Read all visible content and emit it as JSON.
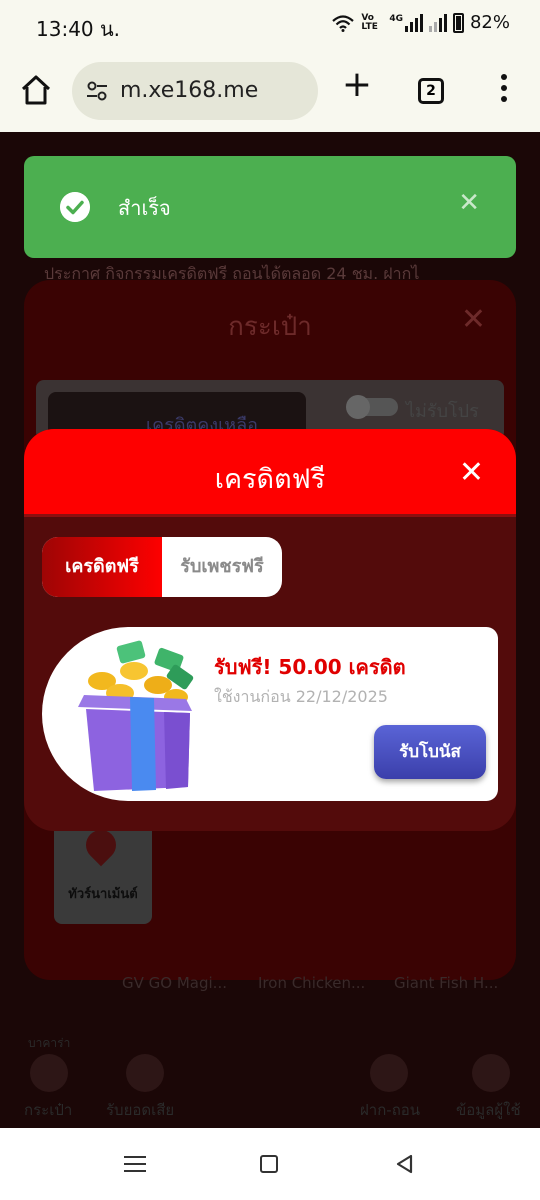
{
  "status_bar": {
    "time": "13:40 น.",
    "battery": "82%",
    "volte": "Vo LTE",
    "network": "4G"
  },
  "browser": {
    "url": "m.xe168.me",
    "tab_count": "2"
  },
  "toast": {
    "message": "สำเร็จ"
  },
  "background": {
    "marquee": "ประกาศ กิจกรรมเครดิตฟรี ถอนได้ตลอด 24 ชม. ฝากไ",
    "wallet_title": "กระเป๋า",
    "credit_label": "เครดิตคงเหลือ",
    "no_promo_label": "ไม่รับโปร",
    "tournament_label": "ทัวร์นาเม้นต์",
    "games": [
      "GV GO Magi...",
      "Iron Chicken...",
      "Giant Fish H..."
    ],
    "nav": [
      "กระเป๋า",
      "รับยอดเสีย",
      "ฝาก-ถอน",
      "ข้อมูลผู้ใช้"
    ],
    "side_label": "บาคาร่า"
  },
  "modal": {
    "title": "เครดิตฟรี",
    "tabs": [
      {
        "label": "เครดิตฟรี",
        "active": true
      },
      {
        "label": "รับเพชรฟรี",
        "active": false
      }
    ],
    "card": {
      "title": "รับฟรี! 50.00 เครดิต",
      "date": "ใช้งานก่อน 22/12/2025",
      "button": "รับโบนัส"
    }
  },
  "colors": {
    "accent": "#fe0000",
    "modal_bg": "#530b0b",
    "toast": "#4caf50",
    "button": "#4a52c4"
  }
}
